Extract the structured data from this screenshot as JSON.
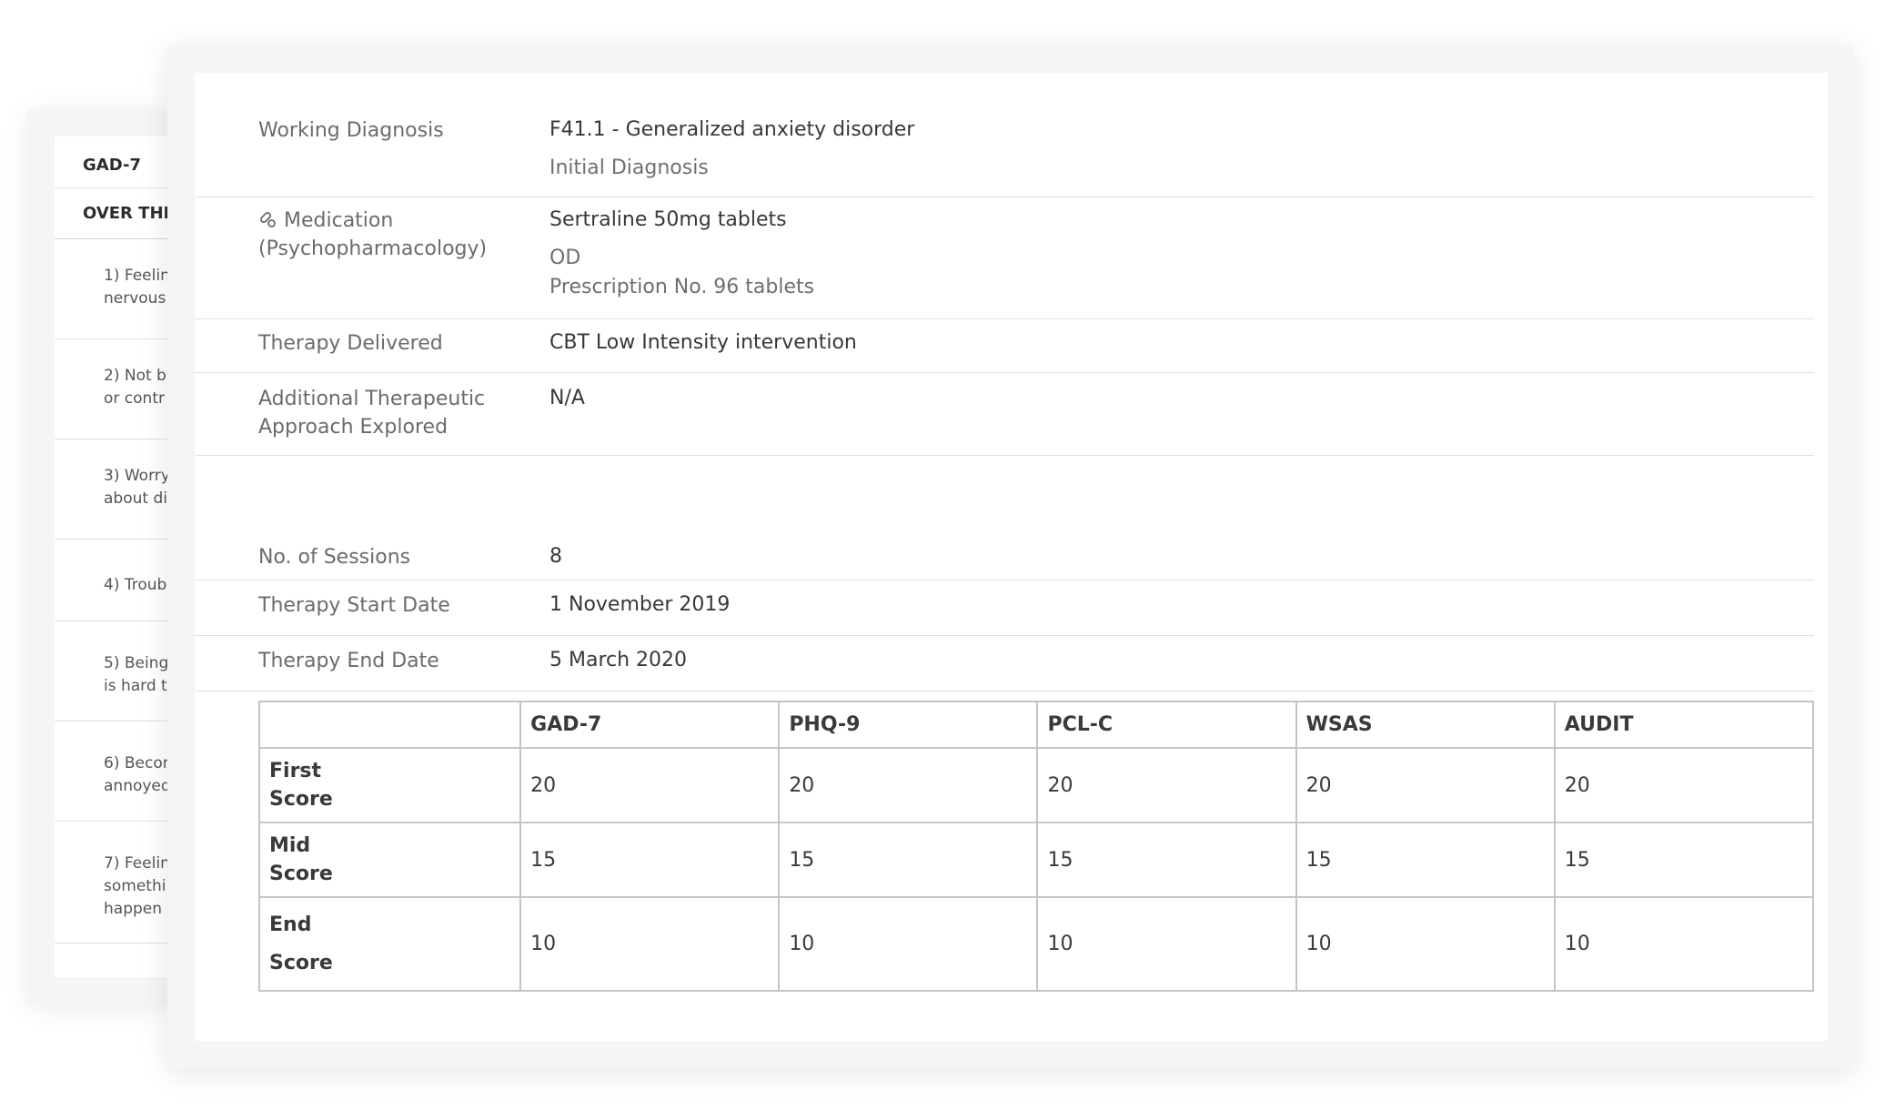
{
  "questionnaire": {
    "title": "GAD-7",
    "subtitle": "OVER THE",
    "questions": [
      {
        "line1": "1) Feelin",
        "line2": "nervous"
      },
      {
        "line1": "2) Not b",
        "line2": "or contr"
      },
      {
        "line1": "3) Worry",
        "line2": "about di"
      },
      {
        "line1": "4) Troub",
        "line2": ""
      },
      {
        "line1": "5) Being",
        "line2": "is hard t"
      },
      {
        "line1": "6) Becon",
        "line2": "annoyed"
      },
      {
        "line1": "7) Feelin",
        "line2": "somethi",
        "line3": "happen"
      }
    ]
  },
  "summary": {
    "working_diagnosis": {
      "label": "Working Diagnosis",
      "value": "F41.1 - Generalized anxiety disorder",
      "note": "Initial Diagnosis"
    },
    "medication": {
      "label_line1": "Medication",
      "label_line2": "(Psychopharmacology)",
      "icon": "pill-icon",
      "value": "Sertraline 50mg tablets",
      "frequency": "OD",
      "prescription": "Prescription No. 96 tablets"
    },
    "therapy_delivered": {
      "label": "Therapy Delivered",
      "value": "CBT Low Intensity intervention"
    },
    "additional_approach": {
      "label_line1": "Additional Therapeutic",
      "label_line2": "Approach Explored",
      "value": "N/A"
    },
    "sessions": {
      "label": "No. of Sessions",
      "value": "8"
    },
    "start_date": {
      "label": "Therapy Start Date",
      "value": "1 November 2019"
    },
    "end_date": {
      "label": "Therapy End Date",
      "value": "5 March 2020"
    }
  },
  "scores": {
    "columns": [
      "GAD-7",
      "PHQ-9",
      "PCL-C",
      "WSAS",
      "AUDIT"
    ],
    "rows": [
      {
        "label_line1": "First",
        "label_line2": "Score",
        "values": [
          "20",
          "20",
          "20",
          "20",
          "20"
        ]
      },
      {
        "label_line1": "Mid",
        "label_line2": "Score",
        "values": [
          "15",
          "15",
          "15",
          "15",
          "15"
        ]
      },
      {
        "label_line1": "End",
        "label_line2": "Score",
        "values": [
          "10",
          "10",
          "10",
          "10",
          "10"
        ]
      }
    ]
  },
  "colors": {
    "card_background": "#f4f5f7",
    "divider": "#dde1e6",
    "table_border": "#c2c6cb",
    "label_text": "#6b6b6b",
    "value_text": "#383838"
  }
}
